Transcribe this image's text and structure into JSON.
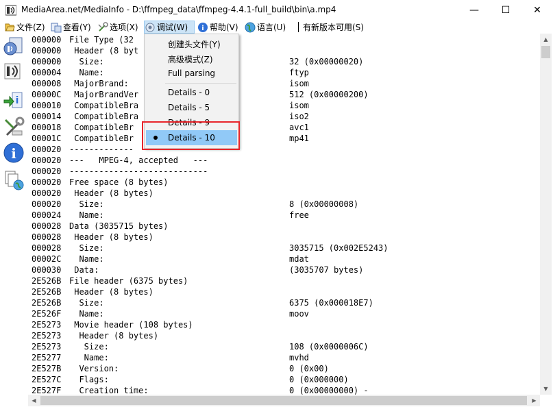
{
  "window": {
    "title": "MediaArea.net/MediaInfo - D:\\ffmpeg_data\\ffmpeg-4.4.1-full_build\\bin\\a.mp4",
    "minimize_label": "—",
    "maximize_label": "☐",
    "close_label": "✕"
  },
  "menu": {
    "file": "文件(Z)",
    "view": "查看(Y)",
    "options": "选项(X)",
    "debug": "调试(W)",
    "help": "帮助(V)",
    "language": "语言(U)",
    "new_version": "有新版本可用(S)"
  },
  "dropdown": {
    "items": [
      {
        "label": "创建头文件(Y)"
      },
      {
        "label": "高级模式(Z)"
      },
      {
        "label": "Full parsing"
      },
      {
        "label": "Details - 0"
      },
      {
        "label": "Details - 5"
      },
      {
        "label": "Details - 9"
      },
      {
        "label": "Details - 10",
        "selected": true
      }
    ]
  },
  "rows": [
    {
      "offset": "000000",
      "text": "File Type (32",
      "value": ""
    },
    {
      "offset": "000000",
      "text": " Header (8 byt",
      "value": ""
    },
    {
      "offset": "000000",
      "text": "  Size:",
      "value": "32 (0x00000020)"
    },
    {
      "offset": "000004",
      "text": "  Name:",
      "value": "ftyp"
    },
    {
      "offset": "000008",
      "text": " MajorBrand:",
      "value": "isom"
    },
    {
      "offset": "00000C",
      "text": " MajorBrandVer",
      "value": "512 (0x00000200)"
    },
    {
      "offset": "000010",
      "text": " CompatibleBra",
      "value": "isom"
    },
    {
      "offset": "000014",
      "text": " CompatibleBra",
      "value": "iso2"
    },
    {
      "offset": "000018",
      "text": " CompatibleBr",
      "value": "avc1"
    },
    {
      "offset": "00001C",
      "text": " CompatibleBr",
      "value": "mp41"
    },
    {
      "offset": "000020",
      "text": "-------------",
      "value": ""
    },
    {
      "offset": "000020",
      "text": "---   MPEG-4, accepted   ---",
      "value": ""
    },
    {
      "offset": "000020",
      "text": "----------------------------",
      "value": ""
    },
    {
      "offset": "000020",
      "text": "Free space (8 bytes)",
      "value": ""
    },
    {
      "offset": "000020",
      "text": " Header (8 bytes)",
      "value": ""
    },
    {
      "offset": "000020",
      "text": "  Size:",
      "value": "8 (0x00000008)"
    },
    {
      "offset": "000024",
      "text": "  Name:",
      "value": "free"
    },
    {
      "offset": "000028",
      "text": "Data (3035715 bytes)",
      "value": ""
    },
    {
      "offset": "000028",
      "text": " Header (8 bytes)",
      "value": ""
    },
    {
      "offset": "000028",
      "text": "  Size:",
      "value": "3035715 (0x002E5243)"
    },
    {
      "offset": "00002C",
      "text": "  Name:",
      "value": "mdat"
    },
    {
      "offset": "000030",
      "text": " Data:",
      "value": "(3035707 bytes)"
    },
    {
      "offset": "2E526B",
      "text": "File header (6375 bytes)",
      "value": ""
    },
    {
      "offset": "2E526B",
      "text": " Header (8 bytes)",
      "value": ""
    },
    {
      "offset": "2E526B",
      "text": "  Size:",
      "value": "6375 (0x000018E7)"
    },
    {
      "offset": "2E526F",
      "text": "  Name:",
      "value": "moov"
    },
    {
      "offset": "2E5273",
      "text": " Movie header (108 bytes)",
      "value": ""
    },
    {
      "offset": "2E5273",
      "text": "  Header (8 bytes)",
      "value": ""
    },
    {
      "offset": "2E5273",
      "text": "   Size:",
      "value": "108 (0x0000006C)"
    },
    {
      "offset": "2E5277",
      "text": "   Name:",
      "value": "mvhd"
    },
    {
      "offset": "2E527B",
      "text": "  Version:",
      "value": "0 (0x00)"
    },
    {
      "offset": "2E527C",
      "text": "  Flags:",
      "value": "0 (0x000000)"
    },
    {
      "offset": "2E527F",
      "text": "  Creation time:",
      "value": "0 (0x00000000) -"
    }
  ]
}
